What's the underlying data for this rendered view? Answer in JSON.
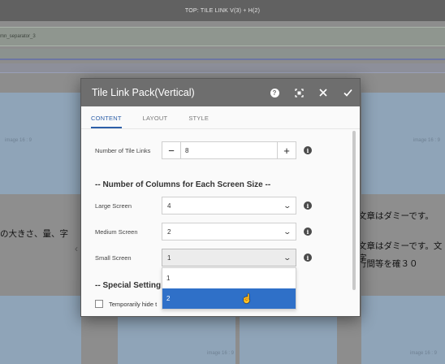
{
  "topbar": {
    "title": "TOP: TILE LINK V(3) + H(2)"
  },
  "background": {
    "separator_label": "mn_separator_3",
    "tile_caption_left": "image 16 : 9",
    "tile_caption_right": "image 16 : 9",
    "tile_caption_bottom_mid": "image 16 : 9",
    "tile_caption_bottom_right": "image 16 : 9",
    "text_left": "の大きさ、量、字",
    "text_right_1": "文章はダミーです。",
    "text_right_2": "文章はダミーです。文字",
    "text_right_3": "行間等を確３０"
  },
  "dialog": {
    "title": "Tile Link Pack(Vertical)",
    "header_icons": [
      "help-icon",
      "fullscreen-icon",
      "close-icon",
      "done-icon"
    ],
    "tabs": [
      {
        "label": "CONTENT",
        "active": true
      },
      {
        "label": "LAYOUT",
        "active": false
      },
      {
        "label": "STYLE",
        "active": false
      }
    ],
    "tile_links": {
      "label": "Number of Tile Links",
      "value": "8",
      "minus": "−",
      "plus": "+"
    },
    "columns_section": "-- Number of Columns for Each Screen Size --",
    "large_screen": {
      "label": "Large Screen",
      "value": "4"
    },
    "medium_screen": {
      "label": "Medium Screen",
      "value": "2"
    },
    "small_screen": {
      "label": "Small Screen",
      "value": "1",
      "options": [
        "1",
        "2"
      ],
      "highlighted": "2"
    },
    "special_section": "-- Special Setting",
    "temp_hide": {
      "label": "Temporarily hide t"
    },
    "info_glyph": "i"
  },
  "colors": {
    "accent": "#2d5fa8",
    "highlight": "#2f70c8",
    "header": "#6e6e6e"
  }
}
